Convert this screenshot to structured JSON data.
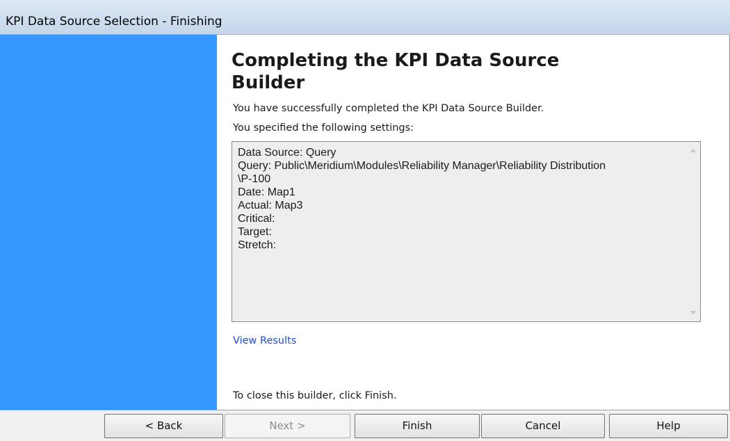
{
  "window": {
    "title": "KPI Data Source Selection - Finishing"
  },
  "content": {
    "heading": "Completing the KPI Data Source Builder",
    "success_message": "You have successfully completed the KPI Data Source Builder.",
    "settings_intro": "You specified the following settings:",
    "settings_lines": [
      "Data Source: Query",
      "Query: Public\\Meridium\\Modules\\Reliability Manager\\Reliability Distribution",
      "\\P-100",
      "Date: Map1",
      "Actual: Map3",
      "Critical:",
      "Target:",
      "Stretch:"
    ],
    "view_results_link": "View Results",
    "closing_instruction": "To close this builder, click Finish."
  },
  "buttons": {
    "back": "< Back",
    "next": "Next >",
    "finish": "Finish",
    "cancel": "Cancel",
    "help": "Help"
  },
  "colors": {
    "sidebar": "#3399ff",
    "link": "#1f4ec9",
    "titlebar": "#c4d6ea"
  }
}
